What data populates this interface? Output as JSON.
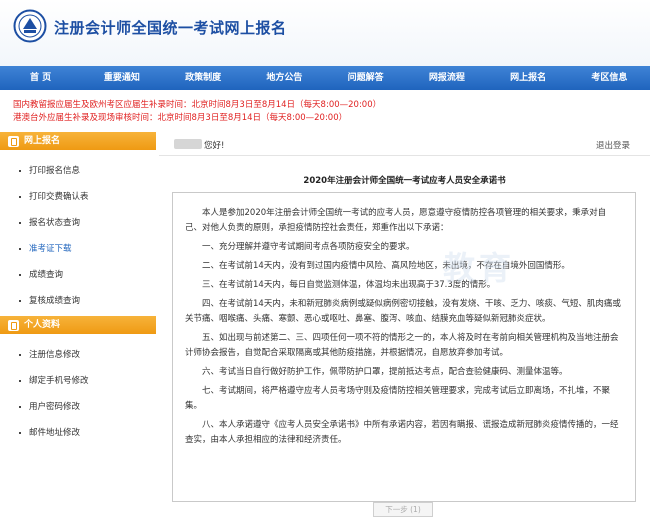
{
  "header": {
    "site_title": "注册会计师全国统一考试网上报名"
  },
  "nav": {
    "items": [
      "首 页",
      "重要通知",
      "政策制度",
      "地方公告",
      "问题解答",
      "网报流程",
      "网上报名",
      "考区信息"
    ]
  },
  "notices": [
    "国内教留报应届生及欧州考区应届生补录时间：北京时间8月3日至8月14日（每天8:00—20:00）",
    "港澳台外应届生补录及现场审核时间：北京时间8月3日至8月14日（每天8:00—20:00）"
  ],
  "sidebar": {
    "section1_title": "网上报名",
    "section1_items": [
      "打印报名信息",
      "打印交费确认表",
      "报名状态查询",
      "准考证下载",
      "成绩查询",
      "复核成绩查询"
    ],
    "section2_title": "个人资料",
    "section2_items": [
      "注册信息修改",
      "绑定手机号修改",
      "用户密码修改",
      "邮件地址修改"
    ]
  },
  "main": {
    "greeting": "您好!",
    "logout": "退出登录",
    "doc_title": "2020年注册会计师全国统一考试应考人员安全承诺书",
    "paragraphs": [
      "本人是参加2020年注册会计师全国统一考试的应考人员，愿意遵守疫情防控各项管理的相关要求，秉承对自己、对他人负责的原则，承担疫情防控社会责任，郑重作出以下承诺：",
      "一、充分理解并遵守考试期间考点各项防疫安全的要求。",
      "二、在考试前14天内，没有到过国内疫情中风险、高风险地区，未出境，不存在自境外回国情形。",
      "三、在考试前14天内，每日自觉监测体温，体温均未出现高于37.3度的情形。",
      "四、在考试前14天内，未和新冠肺炎病例或疑似病例密切接触，没有发烧、干咳、乏力、咳痰、气短、肌肉痛或关节痛、咽喉痛、头痛、寒颤、恶心或呕吐、鼻塞、腹泻、咳血、结膜充血等疑似新冠肺炎症状。",
      "五、如出现与前述第二、三、四项任何一项不符的情形之一的，本人将及时在考前向相关管理机构及当地注册会计师协会报告，自觉配合采取隔离或其他防疫措施，并根据情况，自愿放弃参加考试。",
      "六、考试当日自行做好防护工作，佩带防护口罩，提前抵达考点，配合查验健康码、测量体温等。",
      "七、考试期间，将严格遵守应考人员考场守则及疫情防控相关管理要求，完成考试后立即离场，不扎堆，不聚集。",
      "八、本人承诺遵守《应考人员安全承诺书》中所有承诺内容，若因有瞒报、谎报造成新冠肺炎疫情传播的，一经查实，由本人承担相应的法律和经济责任。"
    ],
    "watermark": "教育",
    "next_button": "下一步 (1)"
  },
  "colors": {
    "nav_blue": "#1f64bd",
    "notice_red": "#e02222",
    "sidebar_orange": "#ef9a13"
  }
}
